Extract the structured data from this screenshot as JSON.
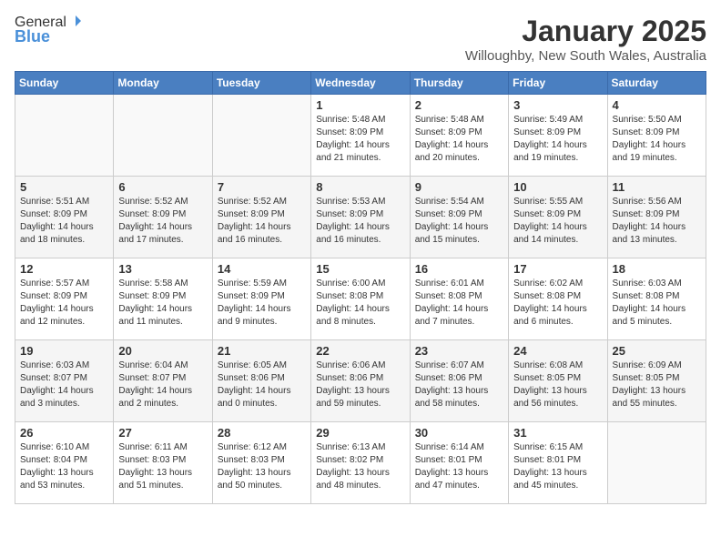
{
  "logo": {
    "general": "General",
    "blue": "Blue"
  },
  "title": "January 2025",
  "location": "Willoughby, New South Wales, Australia",
  "days_of_week": [
    "Sunday",
    "Monday",
    "Tuesday",
    "Wednesday",
    "Thursday",
    "Friday",
    "Saturday"
  ],
  "weeks": [
    [
      {
        "day": "",
        "info": ""
      },
      {
        "day": "",
        "info": ""
      },
      {
        "day": "",
        "info": ""
      },
      {
        "day": "1",
        "info": "Sunrise: 5:48 AM\nSunset: 8:09 PM\nDaylight: 14 hours and 21 minutes."
      },
      {
        "day": "2",
        "info": "Sunrise: 5:48 AM\nSunset: 8:09 PM\nDaylight: 14 hours and 20 minutes."
      },
      {
        "day": "3",
        "info": "Sunrise: 5:49 AM\nSunset: 8:09 PM\nDaylight: 14 hours and 19 minutes."
      },
      {
        "day": "4",
        "info": "Sunrise: 5:50 AM\nSunset: 8:09 PM\nDaylight: 14 hours and 19 minutes."
      }
    ],
    [
      {
        "day": "5",
        "info": "Sunrise: 5:51 AM\nSunset: 8:09 PM\nDaylight: 14 hours and 18 minutes."
      },
      {
        "day": "6",
        "info": "Sunrise: 5:52 AM\nSunset: 8:09 PM\nDaylight: 14 hours and 17 minutes."
      },
      {
        "day": "7",
        "info": "Sunrise: 5:52 AM\nSunset: 8:09 PM\nDaylight: 14 hours and 16 minutes."
      },
      {
        "day": "8",
        "info": "Sunrise: 5:53 AM\nSunset: 8:09 PM\nDaylight: 14 hours and 16 minutes."
      },
      {
        "day": "9",
        "info": "Sunrise: 5:54 AM\nSunset: 8:09 PM\nDaylight: 14 hours and 15 minutes."
      },
      {
        "day": "10",
        "info": "Sunrise: 5:55 AM\nSunset: 8:09 PM\nDaylight: 14 hours and 14 minutes."
      },
      {
        "day": "11",
        "info": "Sunrise: 5:56 AM\nSunset: 8:09 PM\nDaylight: 14 hours and 13 minutes."
      }
    ],
    [
      {
        "day": "12",
        "info": "Sunrise: 5:57 AM\nSunset: 8:09 PM\nDaylight: 14 hours and 12 minutes."
      },
      {
        "day": "13",
        "info": "Sunrise: 5:58 AM\nSunset: 8:09 PM\nDaylight: 14 hours and 11 minutes."
      },
      {
        "day": "14",
        "info": "Sunrise: 5:59 AM\nSunset: 8:09 PM\nDaylight: 14 hours and 9 minutes."
      },
      {
        "day": "15",
        "info": "Sunrise: 6:00 AM\nSunset: 8:08 PM\nDaylight: 14 hours and 8 minutes."
      },
      {
        "day": "16",
        "info": "Sunrise: 6:01 AM\nSunset: 8:08 PM\nDaylight: 14 hours and 7 minutes."
      },
      {
        "day": "17",
        "info": "Sunrise: 6:02 AM\nSunset: 8:08 PM\nDaylight: 14 hours and 6 minutes."
      },
      {
        "day": "18",
        "info": "Sunrise: 6:03 AM\nSunset: 8:08 PM\nDaylight: 14 hours and 5 minutes."
      }
    ],
    [
      {
        "day": "19",
        "info": "Sunrise: 6:03 AM\nSunset: 8:07 PM\nDaylight: 14 hours and 3 minutes."
      },
      {
        "day": "20",
        "info": "Sunrise: 6:04 AM\nSunset: 8:07 PM\nDaylight: 14 hours and 2 minutes."
      },
      {
        "day": "21",
        "info": "Sunrise: 6:05 AM\nSunset: 8:06 PM\nDaylight: 14 hours and 0 minutes."
      },
      {
        "day": "22",
        "info": "Sunrise: 6:06 AM\nSunset: 8:06 PM\nDaylight: 13 hours and 59 minutes."
      },
      {
        "day": "23",
        "info": "Sunrise: 6:07 AM\nSunset: 8:06 PM\nDaylight: 13 hours and 58 minutes."
      },
      {
        "day": "24",
        "info": "Sunrise: 6:08 AM\nSunset: 8:05 PM\nDaylight: 13 hours and 56 minutes."
      },
      {
        "day": "25",
        "info": "Sunrise: 6:09 AM\nSunset: 8:05 PM\nDaylight: 13 hours and 55 minutes."
      }
    ],
    [
      {
        "day": "26",
        "info": "Sunrise: 6:10 AM\nSunset: 8:04 PM\nDaylight: 13 hours and 53 minutes."
      },
      {
        "day": "27",
        "info": "Sunrise: 6:11 AM\nSunset: 8:03 PM\nDaylight: 13 hours and 51 minutes."
      },
      {
        "day": "28",
        "info": "Sunrise: 6:12 AM\nSunset: 8:03 PM\nDaylight: 13 hours and 50 minutes."
      },
      {
        "day": "29",
        "info": "Sunrise: 6:13 AM\nSunset: 8:02 PM\nDaylight: 13 hours and 48 minutes."
      },
      {
        "day": "30",
        "info": "Sunrise: 6:14 AM\nSunset: 8:01 PM\nDaylight: 13 hours and 47 minutes."
      },
      {
        "day": "31",
        "info": "Sunrise: 6:15 AM\nSunset: 8:01 PM\nDaylight: 13 hours and 45 minutes."
      },
      {
        "day": "",
        "info": ""
      }
    ]
  ]
}
